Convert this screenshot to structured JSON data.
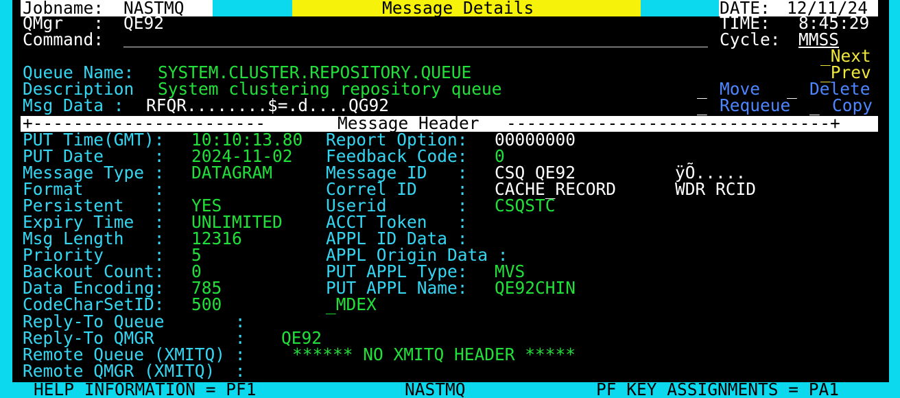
{
  "header": {
    "jobname_label": "Jobname:",
    "jobname": "NASTMQ",
    "title": "Message Details",
    "date_label": "DATE:",
    "date": "12/11/24",
    "qmgr_label": "QMgr   :",
    "qmgr": "QE92",
    "time_label": "TIME:",
    "time": "8:45:29",
    "command_label": "Command:",
    "command_value": "",
    "cycle_label": "Cycle:",
    "cycle": "MMSS"
  },
  "nav": {
    "next": "_Next",
    "prev": "_Prev"
  },
  "queue": {
    "name_label": "Queue Name:",
    "name": "SYSTEM.CLUSTER.REPOSITORY.QUEUE",
    "desc_label": "Description",
    "desc": "System clustering repository queue",
    "msgdata_label": "Msg Data :",
    "msgdata": "RFQR........$=.d....QG92"
  },
  "actions": {
    "move": "Move",
    "delete": "Delete",
    "requeue": "Requeue",
    "copy": "Copy",
    "marker": "_"
  },
  "section_header": {
    "left_rule": "+-----------------------",
    "title": "Message Header",
    "right_rule": "--------------------------------+"
  },
  "left_fields": [
    {
      "label": "PUT Time(GMT):",
      "value": "10:10:13.80"
    },
    {
      "label": "PUT Date     :",
      "value": "2024-11-02"
    },
    {
      "label": "Message Type :",
      "value": "DATAGRAM"
    },
    {
      "label": "Format       :",
      "value": ""
    },
    {
      "label": "Persistent   :",
      "value": "YES"
    },
    {
      "label": "Expiry Time  :",
      "value": "UNLIMITED"
    },
    {
      "label": "Msg Length   :",
      "value": "12316"
    },
    {
      "label": "Priority     :",
      "value": "5"
    },
    {
      "label": "Backout Count:",
      "value": "0"
    },
    {
      "label": "Data Encoding:",
      "value": "785"
    },
    {
      "label": "CodeCharSetID:",
      "value": "500"
    }
  ],
  "right_fields": [
    {
      "label": "Report Option:",
      "value": "00000000"
    },
    {
      "label": "Feedback Code:",
      "value": "0"
    },
    {
      "label": "Message ID   :",
      "value": "CSQ QE92",
      "extra": "ÿÕ....."
    },
    {
      "label": "Correl ID    :",
      "value": "CACHE_RECORD",
      "extra": "WDR RCID"
    },
    {
      "label": "Userid       :",
      "value": "CSQSTC"
    },
    {
      "label": "ACCT Token   :",
      "value": ""
    },
    {
      "label": "APPL ID Data :",
      "value": ""
    },
    {
      "label": "APPL Origin Data :",
      "value": ""
    },
    {
      "label": "PUT APPL Type:",
      "value": "MVS"
    },
    {
      "label": "PUT APPL Name:",
      "value": "QE92CHIN"
    },
    {
      "label": "_MDEX",
      "value": ""
    }
  ],
  "reply": [
    {
      "label": "Reply-To Queue       :",
      "value": ""
    },
    {
      "label": "Reply-To QMGR        :",
      "value": "QE92"
    },
    {
      "label": "Remote Queue (XMITQ) :",
      "value": "****** NO XMITQ HEADER *****"
    },
    {
      "label": "Remote QMGR (XMITQ)  :",
      "value": ""
    }
  ],
  "footer": {
    "help": "HELP INFORMATION = PF1",
    "center": "NASTMQ",
    "pf": "PF KEY ASSIGNMENTS = PA1"
  },
  "colors": {
    "label": "#35d6f2",
    "value": "#22e03a",
    "white": "#ffffff",
    "nav": "#f0e83a",
    "action": "#4d86ff",
    "frame": "#0dd9ee"
  }
}
